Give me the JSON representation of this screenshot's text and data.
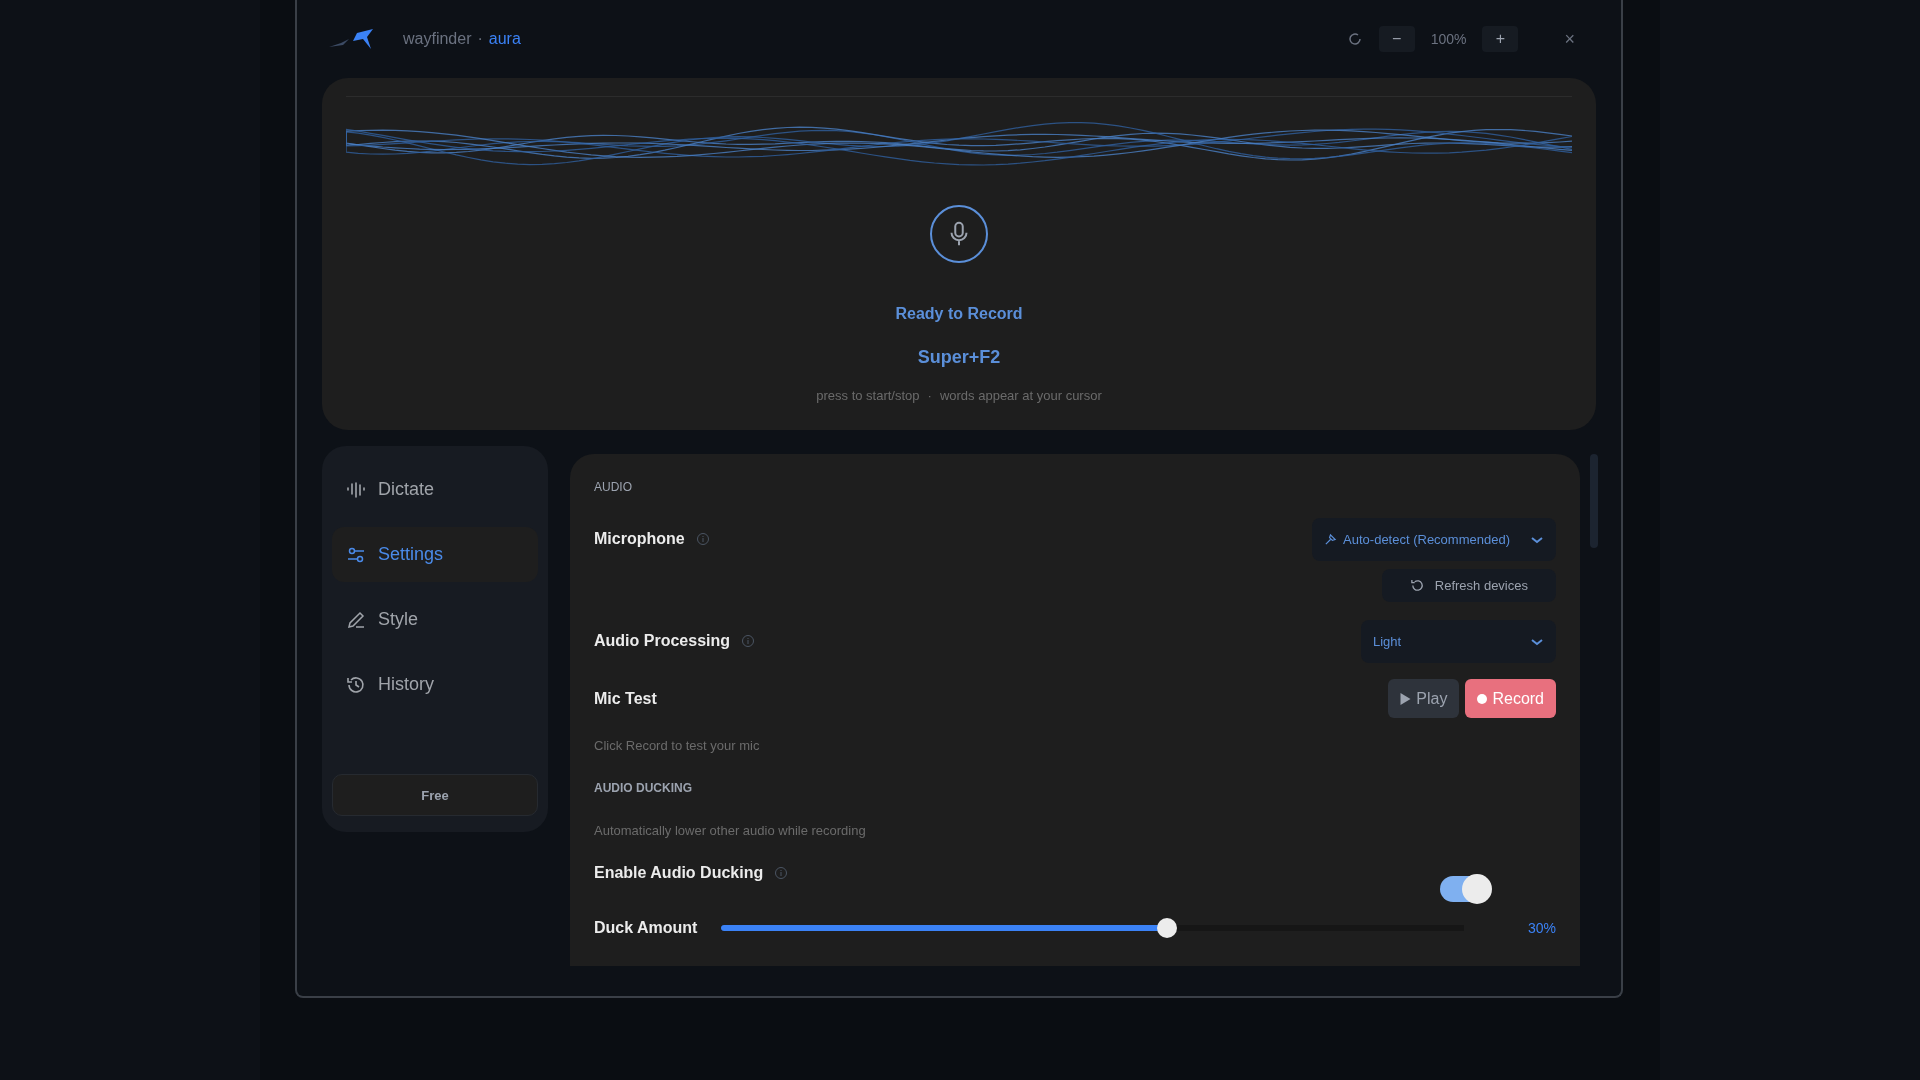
{
  "window": {
    "app_name": "wayfinder",
    "separator": "·",
    "product": "aura",
    "zoom_out": "−",
    "zoom": "100%",
    "zoom_in": "+",
    "close": "×"
  },
  "hero": {
    "status": "Ready to Record",
    "shortcut": "Super+F2",
    "hint_start": "press to start/stop",
    "hint_separator": "·",
    "hint_end": "words appear at your cursor"
  },
  "nav": {
    "items": [
      {
        "label": "Dictate",
        "kind": "wave",
        "selected": false
      },
      {
        "label": "Settings",
        "kind": "sliders",
        "selected": true
      },
      {
        "label": "Style",
        "kind": "pen",
        "selected": false
      },
      {
        "label": "History",
        "kind": "history",
        "selected": false
      }
    ],
    "plan": "Free"
  },
  "settings": {
    "section": "AUDIO",
    "rows": [
      {
        "kind": "select",
        "label": "Microphone",
        "info": true,
        "value": "Auto-detect (Recommended)",
        "value_icon": true,
        "action": "Refresh devices"
      },
      {
        "kind": "select",
        "label": "Audio Processing",
        "info": true,
        "value": "Light",
        "value_icon": false
      },
      {
        "kind": "mictest",
        "label": "Mic Test",
        "play": "Play",
        "record": "Record",
        "hint": "Click Record to test your mic"
      },
      {
        "kind": "heading",
        "label": "AUDIO DUCKING"
      },
      {
        "kind": "note",
        "label": "Automatically lower other audio while recording"
      },
      {
        "kind": "toggle",
        "label": "Enable Audio Ducking",
        "info": true,
        "on": true
      },
      {
        "kind": "slider",
        "label": "Duck Amount",
        "level": 0.6,
        "reading": "30%"
      }
    ]
  }
}
